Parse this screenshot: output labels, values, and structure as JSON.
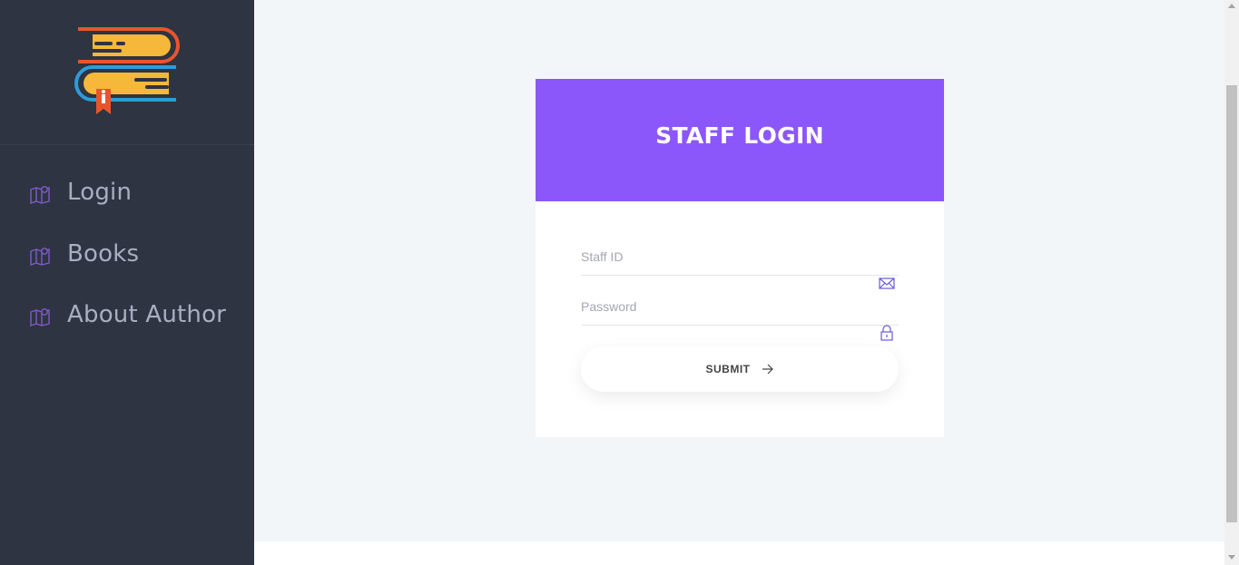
{
  "sidebar": {
    "logo_icon": "books-stack-icon",
    "items": [
      {
        "label": "Login",
        "icon": "map-pin-icon"
      },
      {
        "label": "Books",
        "icon": "map-pin-icon"
      },
      {
        "label": "About Author",
        "icon": "map-pin-icon"
      }
    ]
  },
  "login_card": {
    "title": "STAFF LOGIN",
    "staff_id": {
      "placeholder": "Staff ID",
      "value": "",
      "icon": "envelope-icon"
    },
    "password": {
      "placeholder": "Password",
      "value": "",
      "icon": "lock-icon"
    },
    "submit_label": "SUBMIT",
    "submit_icon": "arrow-right-icon"
  },
  "colors": {
    "sidebar_bg": "#2e3442",
    "accent": "#8b57fb",
    "nav_text": "#a9aec0",
    "page_bg": "#f3f6f8"
  }
}
